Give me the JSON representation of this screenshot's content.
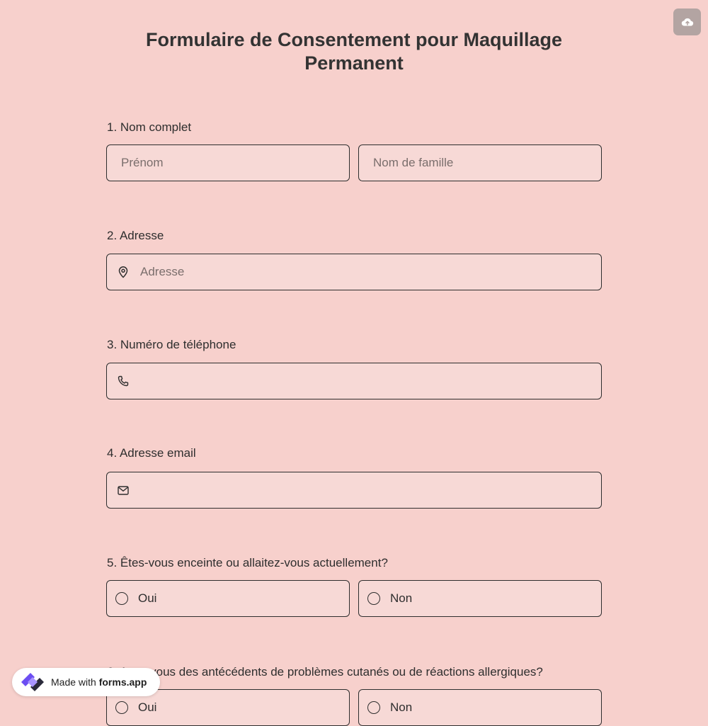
{
  "header": {
    "title_line1": "Formulaire de Consentement pour Maquillage",
    "title_line2": "Permanent",
    "upload_icon": "cloud-upload-icon"
  },
  "questions": {
    "q1": {
      "label": "1.  Nom complet",
      "first_placeholder": "Prénom",
      "last_placeholder": "Nom de famille"
    },
    "q2": {
      "label": "2. Adresse",
      "placeholder": "Adresse",
      "icon": "location-pin-icon"
    },
    "q3": {
      "label": "3. Numéro de téléphone",
      "icon": "phone-icon"
    },
    "q4": {
      "label": "4. Adresse email",
      "icon": "mail-icon"
    },
    "q5": {
      "label": "5. Êtes-vous enceinte ou allaitez-vous actuellement?",
      "option_yes": "Oui",
      "option_no": "Non"
    },
    "q6": {
      "label": "6. Avez-vous des antécédents de problèmes cutanés ou de réactions allergiques?",
      "option_yes": "Oui",
      "option_no": "Non"
    }
  },
  "badge": {
    "prefix": "Made with ",
    "brand": "forms.app"
  },
  "colors": {
    "background": "#f7d0cc",
    "field_background": "#f7d9d6",
    "border": "#2e2e2e",
    "logo_purple": "#6c4ef2"
  }
}
